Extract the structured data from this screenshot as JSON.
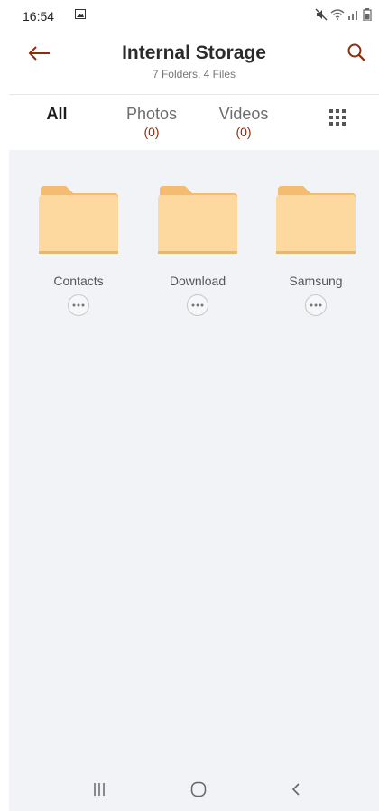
{
  "status_bar": {
    "time": "16:54",
    "left_icons": [
      "gallery-notification-icon"
    ],
    "right_icons": [
      "mute-icon",
      "wifi-icon",
      "signal-icon",
      "battery-icon"
    ]
  },
  "app_bar": {
    "title": "Internal Storage",
    "subtitle": "7 Folders, 4 Files",
    "back_icon": "arrow-left-icon",
    "search_icon": "search-icon"
  },
  "tabs": [
    {
      "label": "All",
      "count": "",
      "selected": true
    },
    {
      "label": "Photos",
      "count": "(0)",
      "selected": false
    },
    {
      "label": "Videos",
      "count": "(0)",
      "selected": false
    }
  ],
  "view_toggle_icon": "grid-view-icon",
  "folders": [
    {
      "name": "Contacts"
    },
    {
      "name": "Download"
    },
    {
      "name": "Samsung"
    }
  ],
  "nav_bar": {
    "recents_icon": "recents-icon",
    "home_icon": "home-icon",
    "back_icon": "back-icon"
  },
  "colors": {
    "accent": "#8b2d0f",
    "folder_body": "#fdd9a0",
    "folder_tab": "#f4bc70",
    "background": "#f1f3f6"
  }
}
